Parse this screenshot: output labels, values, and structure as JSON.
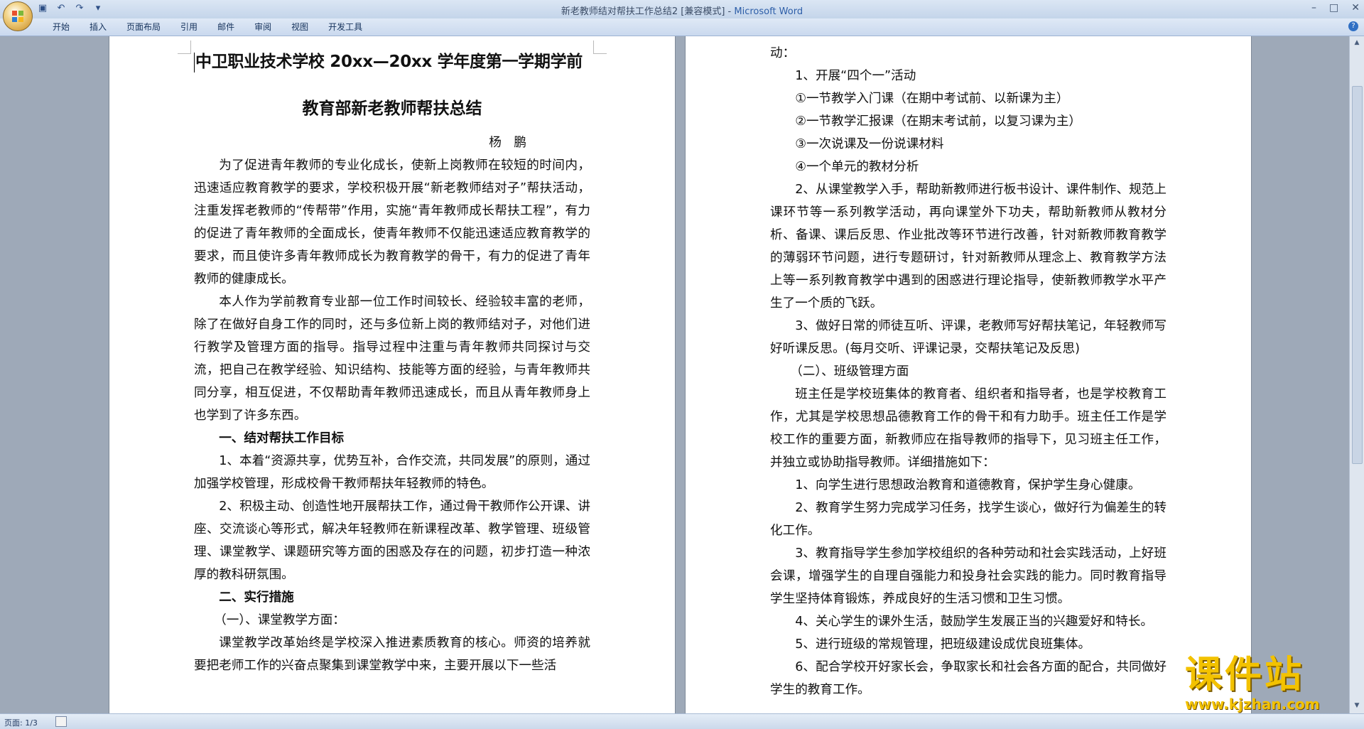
{
  "window": {
    "title_doc": "新老教师结对帮扶工作总结2 [兼容模式] - ",
    "title_app": "Microsoft Word"
  },
  "ribbon": {
    "tabs": [
      "开始",
      "插入",
      "页面布局",
      "引用",
      "邮件",
      "审阅",
      "视图",
      "开发工具"
    ]
  },
  "status": {
    "page_info": "页面: 1/3"
  },
  "doc_left": {
    "title_line1": "中卫职业技术学校 20xx—20xx 学年度第一学期学前",
    "title_line2": "教育部新老教师帮扶总结",
    "author": "杨　鹏",
    "p1": "为了促进青年教师的专业化成长，使新上岗教师在较短的时间内，迅速适应教育教学的要求，学校积极开展“新老教师结对子”帮扶活动，注重发挥老教师的“传帮带”作用，实施“青年教师成长帮扶工程”，有力的促进了青年教师的全面成长，使青年教师不仅能迅速适应教育教学的要求，而且使许多青年教师成长为教育教学的骨干，有力的促进了青年教师的健康成长。",
    "p2": "本人作为学前教育专业部一位工作时间较长、经验较丰富的老师，除了在做好自身工作的同时，还与多位新上岗的教师结对子，对他们进行教学及管理方面的指导。指导过程中注重与青年教师共同探讨与交流，把自己在教学经验、知识结构、技能等方面的经验，与青年教师共同分享，相互促进，不仅帮助青年教师迅速成长，而且从青年教师身上也学到了许多东西。",
    "h1": "一、结对帮扶工作目标",
    "p3": "1、本着“资源共享，优势互补，合作交流，共同发展”的原则，通过加强学校管理，形成校骨干教师帮扶年轻教师的特色。",
    "p4": "2、积极主动、创造性地开展帮扶工作，通过骨干教师作公开课、讲座、交流谈心等形式，解决年轻教师在新课程改革、教学管理、班级管理、课堂教学、课题研究等方面的困惑及存在的问题，初步打造一种浓厚的教科研氛围。",
    "h2": "二、实行措施",
    "sub1": "（一）、课堂教学方面：",
    "p5": "课堂教学改革始终是学校深入推进素质教育的核心。师资的培养就要把老师工作的兴奋点聚集到课堂教学中来，主要开展以下一些活"
  },
  "doc_right": {
    "r0": "动：",
    "r1": "1、开展“四个一”活动",
    "r2": "①一节教学入门课（在期中考试前、以新课为主）",
    "r3": "②一节教学汇报课（在期末考试前，以复习课为主）",
    "r4": "③一次说课及一份说课材料",
    "r5": "④一个单元的教材分析",
    "r6": "2、从课堂教学入手，帮助新教师进行板书设计、课件制作、规范上课环节等一系列教学活动，再向课堂外下功夫，帮助新教师从教材分析、备课、课后反思、作业批改等环节进行改善，针对新教师教育教学的薄弱环节问题，进行专题研讨，针对新教师从理念上、教育教学方法上等一系列教育教学中遇到的困惑进行理论指导，使新教师教学水平产生了一个质的飞跃。",
    "r7": "3、做好日常的师徒互听、评课，老教师写好帮扶笔记，年轻教师写好听课反思。(每月交听、评课记录，交帮扶笔记及反思)",
    "r8": "（二）、班级管理方面",
    "r9": "班主任是学校班集体的教育者、组织者和指导者，也是学校教育工作，尤其是学校思想品德教育工作的骨干和有力助手。班主任工作是学校工作的重要方面，新教师应在指导教师的指导下，见习班主任工作，并独立或协助指导教师。详细措施如下：",
    "r10": "1、向学生进行思想政治教育和道德教育，保护学生身心健康。",
    "r11": "2、教育学生努力完成学习任务，找学生谈心，做好行为偏差生的转化工作。",
    "r12": "3、教育指导学生参加学校组织的各种劳动和社会实践活动，上好班会课，增强学生的自理自强能力和投身社会实践的能力。同时教育指导学生坚持体育锻炼，养成良好的生活习惯和卫生习惯。",
    "r13": "4、关心学生的课外生活，鼓励学生发展正当的兴趣爱好和特长。",
    "r14": "5、进行班级的常规管理，把班级建设成优良班集体。",
    "r15": "6、配合学校开好家长会，争取家长和社会各方面的配合，共同做好学生的教育工作。"
  },
  "watermark": {
    "big": "课件站",
    "url": "www.kjzhan.com"
  }
}
